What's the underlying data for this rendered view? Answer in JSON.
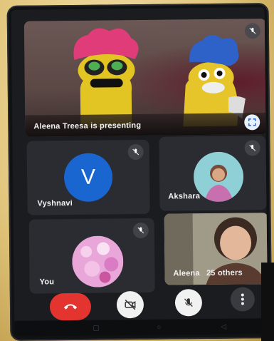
{
  "presenting": {
    "label": "Aleena Treesa is presenting"
  },
  "participants": [
    {
      "name": "Vyshnavi",
      "avatar_letter": "V",
      "avatar_color": "#1a66d1",
      "muted": true
    },
    {
      "name": "Akshara",
      "muted": true
    },
    {
      "name": "You",
      "muted": true
    },
    {
      "name": "Aleena",
      "others": "25 others"
    }
  ],
  "controls": {
    "end_call_color": "#e3342f",
    "icons": [
      "end-call-icon",
      "camera-off-icon",
      "mic-off-icon",
      "more-options-icon"
    ]
  },
  "colors": {
    "tile_bg": "#2a2c31",
    "screen_bg": "#1b1c1f",
    "accent": "#1a66d1"
  }
}
